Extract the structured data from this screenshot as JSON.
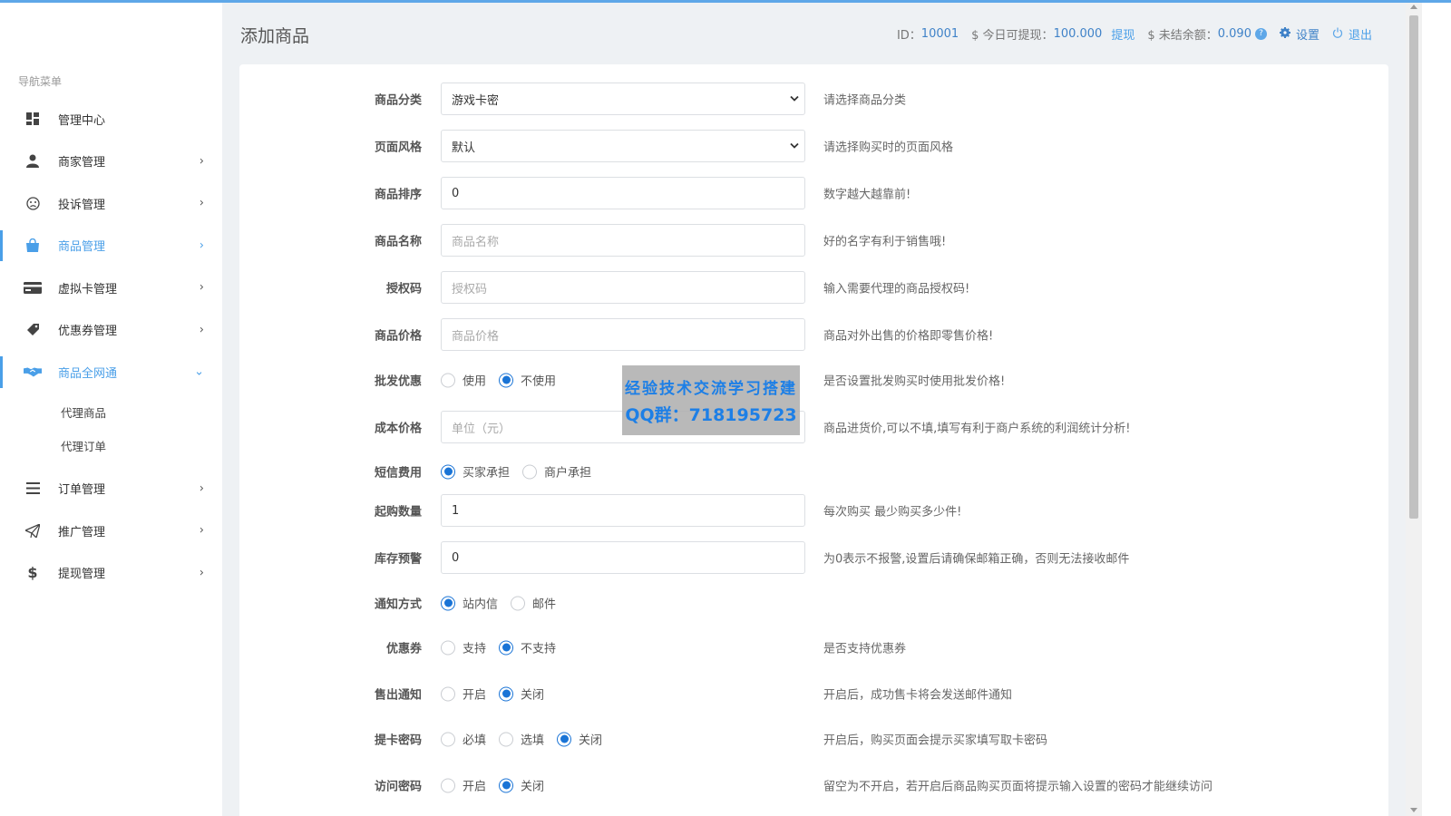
{
  "sidebar": {
    "title": "导航菜单",
    "items": [
      {
        "label": "管理中心",
        "icon": "dashboard-icon",
        "chevron": ""
      },
      {
        "label": "商家管理",
        "icon": "user-icon",
        "chevron": "›"
      },
      {
        "label": "投诉管理",
        "icon": "frown-icon",
        "chevron": "›"
      },
      {
        "label": "商品管理",
        "icon": "shopping-bag-icon",
        "chevron": "›"
      },
      {
        "label": "虚拟卡管理",
        "icon": "credit-card-icon",
        "chevron": "›"
      },
      {
        "label": "优惠券管理",
        "icon": "tag-icon",
        "chevron": "›"
      },
      {
        "label": "商品全网通",
        "icon": "handshake-icon",
        "chevron": "⌄"
      }
    ],
    "sub_items": [
      "代理商品",
      "代理订单"
    ],
    "items2": [
      {
        "label": "订单管理",
        "icon": "list-icon",
        "chevron": "›"
      },
      {
        "label": "推广管理",
        "icon": "paper-plane-icon",
        "chevron": "›"
      },
      {
        "label": "提现管理",
        "icon": "dollar-icon",
        "chevron": "›"
      }
    ]
  },
  "header": {
    "title": "添加商品",
    "id_label": "ID：",
    "id_value": "10001",
    "withdraw_label": "$ 今日可提现：",
    "withdraw_value": "100.000",
    "withdraw_link": "提现",
    "unsettled_label": "$ 未结余额：",
    "unsettled_value": "0.090",
    "help": "?",
    "settings": "设置",
    "logout": "退出"
  },
  "form": {
    "category": {
      "label": "商品分类",
      "value": "游戏卡密",
      "hint": "请选择商品分类"
    },
    "style": {
      "label": "页面风格",
      "value": "默认",
      "hint": "请选择购买时的页面风格"
    },
    "sort": {
      "label": "商品排序",
      "value": "0",
      "hint": "数字越大越靠前!"
    },
    "name": {
      "label": "商品名称",
      "placeholder": "商品名称",
      "hint": "好的名字有利于销售哦!"
    },
    "auth": {
      "label": "授权码",
      "placeholder": "授权码",
      "hint": "输入需要代理的商品授权码!"
    },
    "price": {
      "label": "商品价格",
      "placeholder": "商品价格",
      "hint": "商品对外出售的价格即零售价格!"
    },
    "wholesale": {
      "label": "批发优惠",
      "options": [
        "使用",
        "不使用"
      ],
      "hint": "是否设置批发购买时使用批发价格!"
    },
    "cost": {
      "label": "成本价格",
      "placeholder": "单位（元）",
      "hint": "商品进货价,可以不填,填写有利于商户系统的利润统计分析!"
    },
    "sms": {
      "label": "短信费用",
      "options": [
        "买家承担",
        "商户承担"
      ]
    },
    "min_qty": {
      "label": "起购数量",
      "value": "1",
      "hint": "每次购买 最少购买多少件!"
    },
    "stock_alert": {
      "label": "库存预警",
      "value": "0",
      "hint": "为0表示不报警,设置后请确保邮箱正确，否则无法接收邮件"
    },
    "notify": {
      "label": "通知方式",
      "options": [
        "站内信",
        "邮件"
      ]
    },
    "coupon": {
      "label": "优惠券",
      "options": [
        "支持",
        "不支持"
      ],
      "hint": "是否支持优惠券"
    },
    "sold_notify": {
      "label": "售出通知",
      "options": [
        "开启",
        "关闭"
      ],
      "hint": "开启后，成功售卡将会发送邮件通知"
    },
    "card_pwd": {
      "label": "提卡密码",
      "options": [
        "必填",
        "选填",
        "关闭"
      ],
      "hint": "开启后，购买页面会提示买家填写取卡密码"
    },
    "visit_pwd": {
      "label": "访问密码",
      "options": [
        "开启",
        "关闭"
      ],
      "hint": "留空为不开启，若开启后商品购买页面将提示输入设置的密码才能继续访问"
    }
  },
  "watermark": {
    "line1": "经验技术交流学习搭建",
    "line2": "QQ群：718195723"
  },
  "colors": {
    "accent": "#4a9fe8",
    "radio": "#1a74d6",
    "top_bar": "#5ea7e8"
  }
}
